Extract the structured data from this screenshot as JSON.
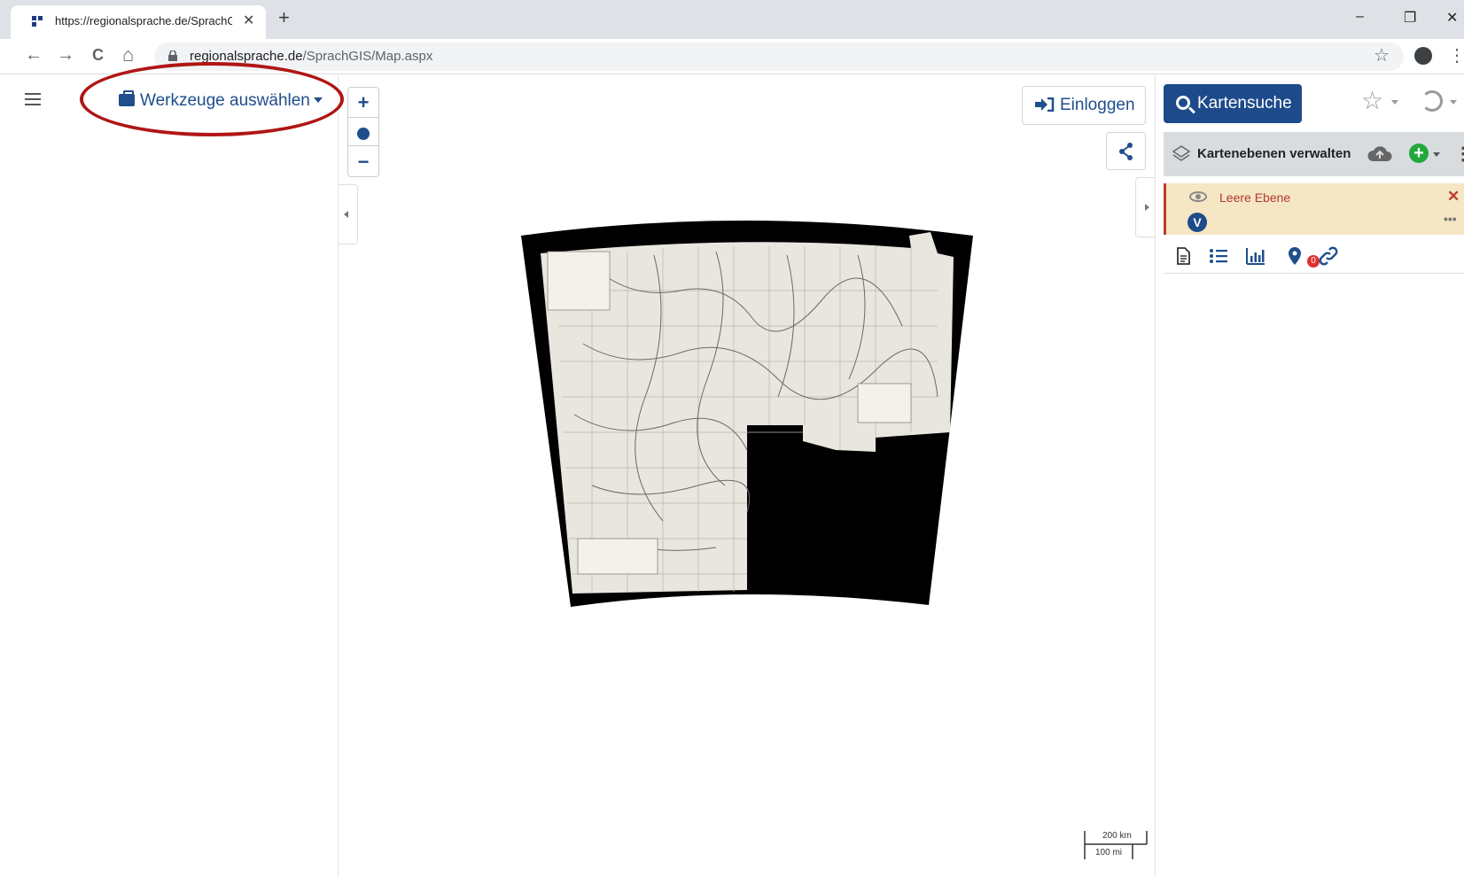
{
  "browser": {
    "tab_title": "https://regionalsprache.de/SprachGIS/Map.aspx",
    "tab_close": "✕",
    "new_tab": "+",
    "url_host": "regionalsprache.de",
    "url_path": "/SprachGIS/Map.aspx",
    "bookmark_star": "☆",
    "menu_dots": "⋮",
    "window_controls": {
      "minimize": "–",
      "restore": "❐",
      "close": "✕"
    },
    "nav": {
      "back": "←",
      "forward": "→",
      "reload": "C",
      "home": "⌂"
    }
  },
  "left_panel": {
    "tools_label": "Werkzeuge auswählen"
  },
  "map_controls": {
    "zoom_in": "+",
    "zoom_out": "−"
  },
  "map_actions": {
    "login_label": "Einloggen"
  },
  "right_panel": {
    "search_label": "Kartensuche",
    "layers_title": "Kartenebenen verwalten",
    "layer": {
      "name": "Leere Ebene",
      "badge": "V",
      "remove": "✕",
      "options": "•••"
    },
    "pin_count": "0"
  },
  "scale": {
    "km": "200 km",
    "mi": "100 mi"
  }
}
